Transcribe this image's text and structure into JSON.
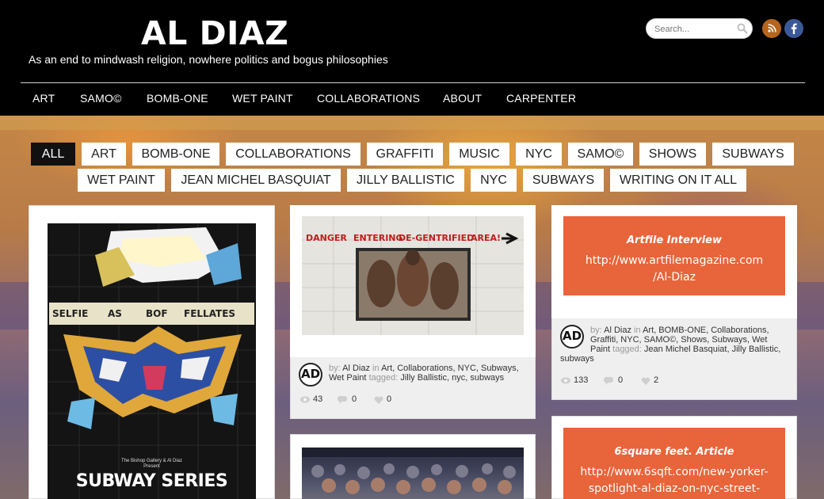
{
  "site": {
    "title": "AL DIAZ",
    "tagline": "As an end to mindwash religion, nowhere politics and bogus philosophies"
  },
  "search": {
    "placeholder": "Search..."
  },
  "social": {
    "rss_icon": "rss-icon",
    "facebook_icon": "facebook-icon"
  },
  "nav": [
    "ART",
    "SAMO©",
    "BOMB-ONE",
    "WET PAINT",
    "COLLABORATIONS",
    "ABOUT",
    "CARPENTER"
  ],
  "filters": {
    "row1": [
      "ALL",
      "ART",
      "BOMB-ONE",
      "COLLABORATIONS",
      "GRAFFITI",
      "MUSIC",
      "NYC",
      "SAMO©",
      "SHOWS",
      "SUBWAYS"
    ],
    "row2": [
      "WET PAINT",
      "JEAN MICHEL BASQUIAT",
      "JILLY BALLISTIC",
      "NYC",
      "SUBWAYS",
      "WRITING ON IT ALL"
    ],
    "active": "ALL"
  },
  "poster": {
    "words": [
      "SELFIE",
      "AS",
      "BOF",
      "FELLATES"
    ],
    "gallery_line1": "The Bishop Gallery & Al Diaz",
    "gallery_line2": "Present",
    "title": "SUBWAY SERIES"
  },
  "post_danger": {
    "sign_words": [
      "DANGER",
      "ENTERING",
      "DE-GENTRIFIED",
      "AREA!"
    ],
    "avatar_initials": "AD",
    "by": "by:",
    "author": "Al Diaz",
    "in": "in",
    "categories": "Art, Collaborations, NYC, Subways,",
    "categories2": "Wet Paint",
    "tagged": "tagged:",
    "tags": "Jilly Ballistic, nyc, subways",
    "views": "43",
    "comments": "0",
    "likes": "0"
  },
  "post_artfile": {
    "title": "Artfile Interview",
    "url_line1": "http://www.artfilemagazine.com",
    "url_line2": "/Al-Diaz",
    "avatar_initials": "AD",
    "by": "by:",
    "author": "Al Diaz",
    "in": "in",
    "cat_line1": "Art, BOMB-ONE, Collaborations,",
    "cat_line2": "Graffiti, NYC, SAMO©, Shows, Subways, Wet",
    "cat_line3a": "Paint",
    "tagged": "tagged:",
    "tags_line3": "Jean Michel Basquiat, Jilly Ballistic,",
    "tags_line4": "subways",
    "views": "133",
    "comments": "0",
    "likes": "2"
  },
  "post_6sqft": {
    "title": "6square feet. Article",
    "url_line1": "http://www.6sqft.com/new-yorker-",
    "url_line2": "spotlight-al-diaz-on-nyc-street-"
  },
  "colors": {
    "orange": "#e8643a",
    "black": "#000000"
  }
}
